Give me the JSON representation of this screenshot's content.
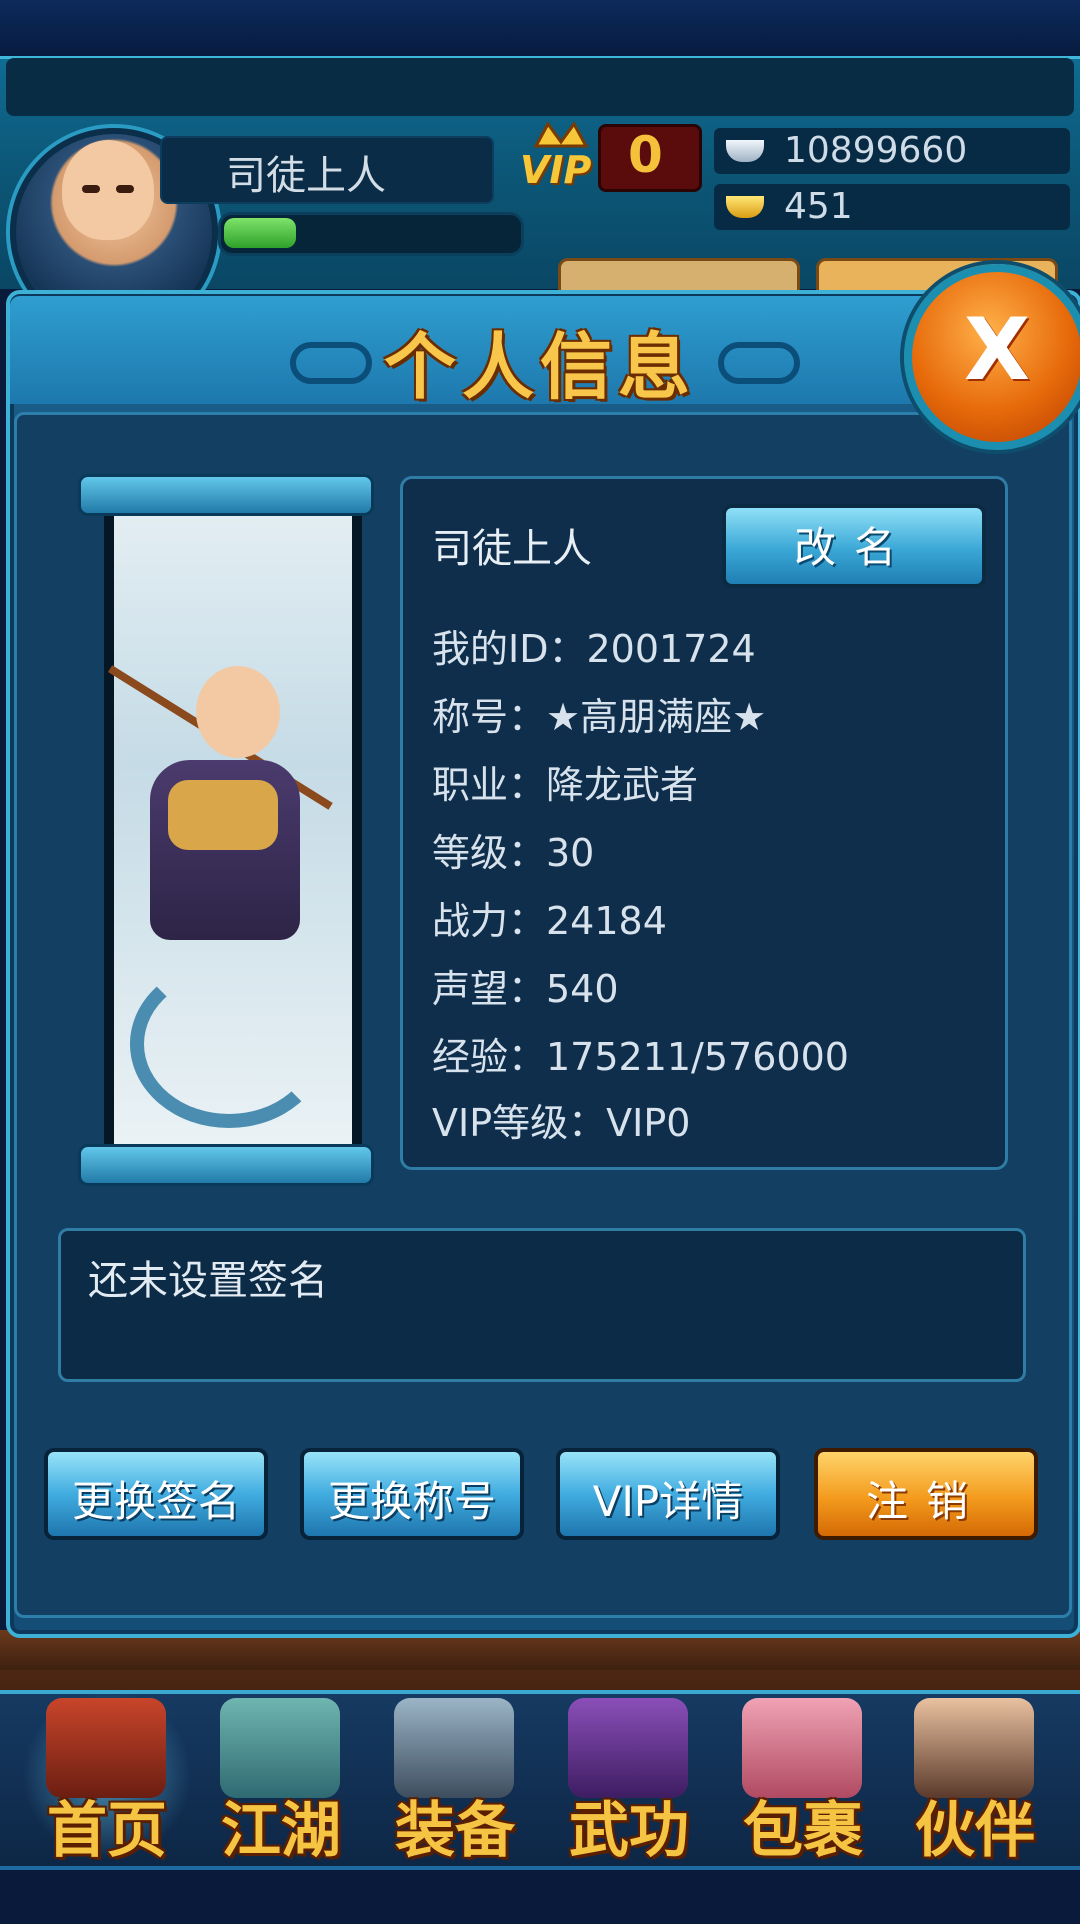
{
  "player": {
    "name": "司徒上人",
    "exp_fill_ratio": 0.25,
    "vip_badge": "VIP",
    "vip_value": "0"
  },
  "currency": {
    "silver": "10899660",
    "gold": "451",
    "silver_icon": "silver-ingot-icon",
    "gold_icon": "gold-ingot-icon"
  },
  "dialog": {
    "title": "个人信息",
    "close_label": "X",
    "info": {
      "name": "司徒上人",
      "rename_label": "改名",
      "id_line": "我的ID：2001724",
      "title_line": "称号：★高朋满座★",
      "job_line": "职业：降龙武者",
      "level_line": "等级：30",
      "power_line": "战力：24184",
      "reputation_line": "声望：540",
      "exp_line": "经验：175211/576000",
      "vip_line": "VIP等级：VIP0"
    },
    "signature": "还未设置签名",
    "buttons": {
      "change_signature": "更换签名",
      "change_title": "更换称号",
      "vip_detail": "VIP详情",
      "logout": "注销"
    }
  },
  "bottom_nav": {
    "items": [
      {
        "label": "首页",
        "icon": "home-palace-icon"
      },
      {
        "label": "江湖",
        "icon": "mountain-icon"
      },
      {
        "label": "装备",
        "icon": "armor-icon"
      },
      {
        "label": "武功",
        "icon": "martial-book-icon"
      },
      {
        "label": "包裹",
        "icon": "bag-icon"
      },
      {
        "label": "伙伴",
        "icon": "partner-icon"
      }
    ]
  },
  "colors": {
    "accent_gold": "#f7c64a",
    "panel_blue": "#1a5d8a",
    "logout_orange": "#f39b1d"
  }
}
